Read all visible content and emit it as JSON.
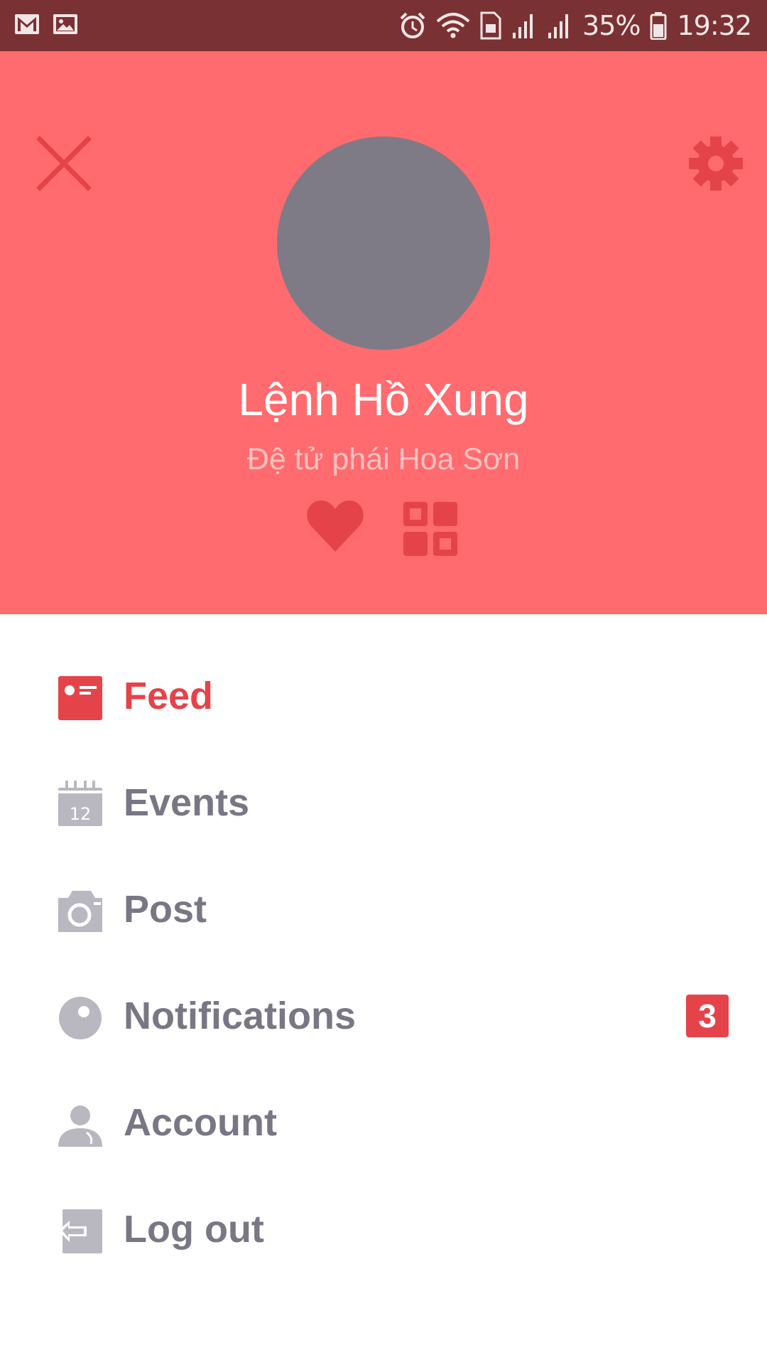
{
  "status_bar": {
    "battery_percent": "35%",
    "time": "19:32"
  },
  "profile": {
    "name": "Lệnh Hồ Xung",
    "subtitle": "Đệ tử phái Hoa Sơn"
  },
  "menu": {
    "items": [
      {
        "label": "Feed",
        "icon": "feed-icon",
        "active": true
      },
      {
        "label": "Events",
        "icon": "calendar-icon",
        "calendar_day": "12"
      },
      {
        "label": "Post",
        "icon": "camera-icon"
      },
      {
        "label": "Notifications",
        "icon": "notification-icon",
        "badge": "3"
      },
      {
        "label": "Account",
        "icon": "user-icon"
      },
      {
        "label": "Log out",
        "icon": "logout-icon"
      }
    ]
  },
  "colors": {
    "status_bar": "#7a3133",
    "header_bg": "#ff6b6e",
    "accent": "#e5434a",
    "avatar": "#7e7a86",
    "menu_text": "#797784",
    "menu_icon": "#b9b7c0"
  }
}
